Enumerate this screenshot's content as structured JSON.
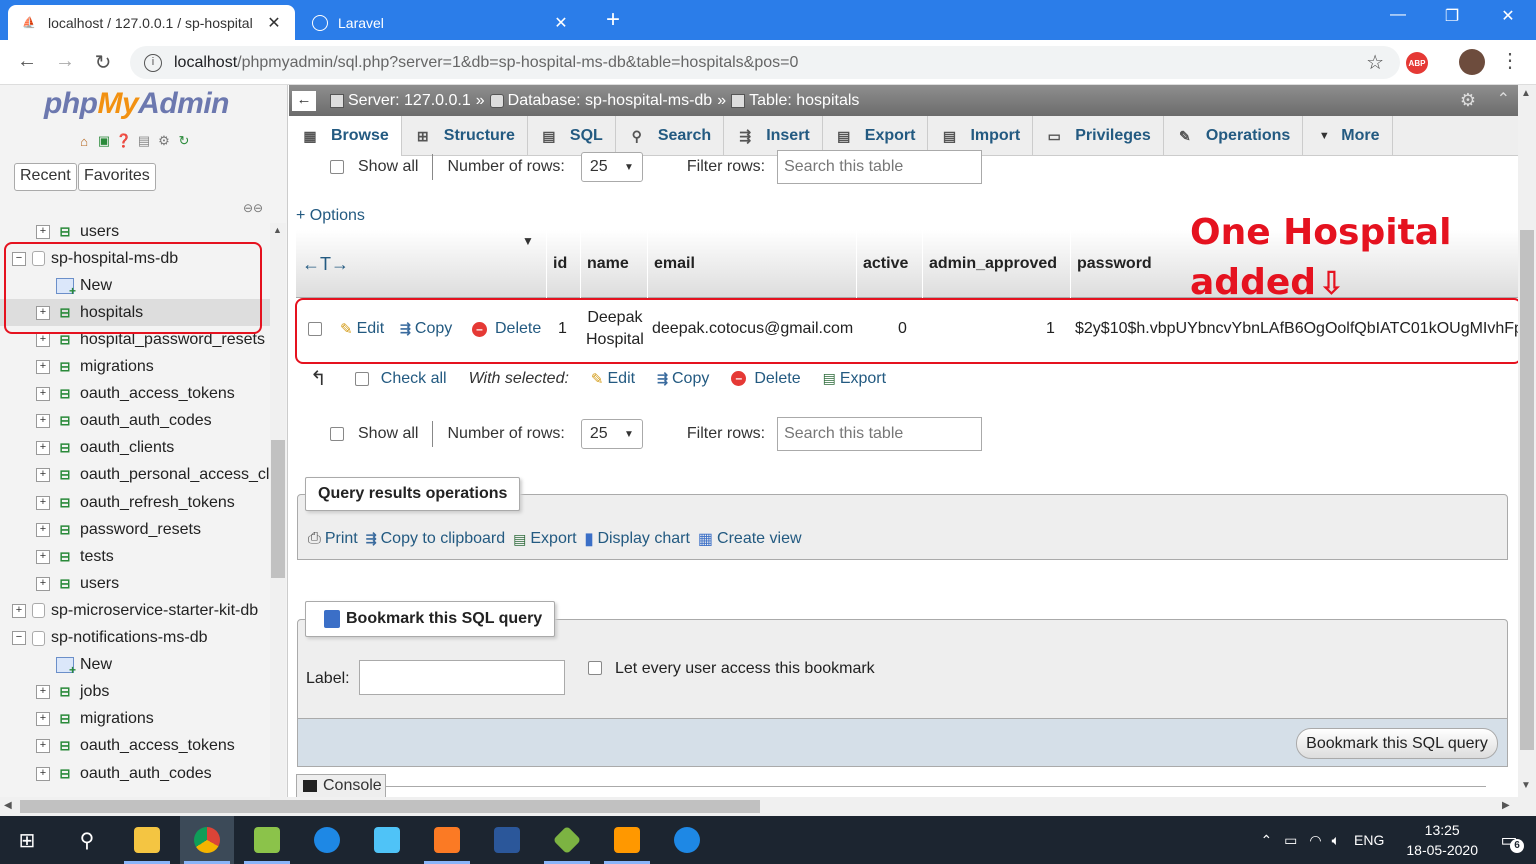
{
  "browser": {
    "tabs": [
      {
        "title": "localhost / 127.0.0.1 / sp-hospital",
        "favicon": "pma",
        "active": true
      },
      {
        "title": "Laravel",
        "favicon": "globe",
        "active": false
      }
    ],
    "url_host": "localhost",
    "url_path": "/phpmyadmin/sql.php?server=1&db=sp-hospital-ms-db&table=hospitals&pos=0",
    "abp_label": "ABP"
  },
  "sidebar": {
    "logo_php": "php",
    "logo_my": "My",
    "logo_admin": "Admin",
    "recent_label": "Recent",
    "favorites_label": "Favorites",
    "tree": [
      {
        "label": "users",
        "type": "table",
        "indent": 1
      },
      {
        "label": "sp-hospital-ms-db",
        "type": "db",
        "indent": 0,
        "expanded": true
      },
      {
        "label": "New",
        "type": "new",
        "indent": 1
      },
      {
        "label": "hospitals",
        "type": "table",
        "indent": 1,
        "selected": true
      },
      {
        "label": "hospital_password_resets",
        "type": "table",
        "indent": 1
      },
      {
        "label": "migrations",
        "type": "table",
        "indent": 1
      },
      {
        "label": "oauth_access_tokens",
        "type": "table",
        "indent": 1
      },
      {
        "label": "oauth_auth_codes",
        "type": "table",
        "indent": 1
      },
      {
        "label": "oauth_clients",
        "type": "table",
        "indent": 1
      },
      {
        "label": "oauth_personal_access_cl",
        "type": "table",
        "indent": 1
      },
      {
        "label": "oauth_refresh_tokens",
        "type": "table",
        "indent": 1
      },
      {
        "label": "password_resets",
        "type": "table",
        "indent": 1
      },
      {
        "label": "tests",
        "type": "table",
        "indent": 1
      },
      {
        "label": "users",
        "type": "table",
        "indent": 1
      },
      {
        "label": "sp-microservice-starter-kit-db",
        "type": "db",
        "indent": 0,
        "expanded": false
      },
      {
        "label": "sp-notifications-ms-db",
        "type": "db",
        "indent": 0,
        "expanded": true
      },
      {
        "label": "New",
        "type": "new",
        "indent": 1
      },
      {
        "label": "jobs",
        "type": "table",
        "indent": 1
      },
      {
        "label": "migrations",
        "type": "table",
        "indent": 1
      },
      {
        "label": "oauth_access_tokens",
        "type": "table",
        "indent": 1
      },
      {
        "label": "oauth_auth_codes",
        "type": "table",
        "indent": 1
      }
    ]
  },
  "breadcrumb": {
    "server": "Server: 127.0.0.1",
    "database": "Database: sp-hospital-ms-db",
    "table": "Table: hospitals",
    "sep": "»"
  },
  "menu": [
    {
      "label": "Browse",
      "icon": "browse-icon",
      "active": true
    },
    {
      "label": "Structure",
      "icon": "structure-icon"
    },
    {
      "label": "SQL",
      "icon": "sql-icon"
    },
    {
      "label": "Search",
      "icon": "search-icon"
    },
    {
      "label": "Insert",
      "icon": "insert-icon"
    },
    {
      "label": "Export",
      "icon": "export-icon"
    },
    {
      "label": "Import",
      "icon": "import-icon"
    },
    {
      "label": "Privileges",
      "icon": "privileges-icon"
    },
    {
      "label": "Operations",
      "icon": "operations-icon"
    },
    {
      "label": "More",
      "icon": "chevron-down-icon"
    }
  ],
  "nav_controls": {
    "show_all": "Show all",
    "rows_label": "Number of rows:",
    "rows_value": "25",
    "filter_label": "Filter rows:",
    "filter_placeholder": "Search this table"
  },
  "options_link": "+ Options",
  "table": {
    "arrows": "←T→",
    "columns": [
      "id",
      "name",
      "email",
      "active",
      "admin_approved",
      "password"
    ],
    "row": {
      "edit": "Edit",
      "copy": "Copy",
      "delete": "Delete",
      "id": "1",
      "name_line1": "Deepak",
      "name_line2": "Hospital",
      "email": "deepak.cotocus@gmail.com",
      "active": "0",
      "admin_approved": "1",
      "password": "$2y$10$h.vbpUYbncvYbnLAfB6OgOolfQbIATC01kOUgMIvhFp"
    }
  },
  "annotation": {
    "line1": "One Hospital",
    "line2": "added",
    "color": "#e5121f"
  },
  "with_selected": {
    "check_all": "Check all",
    "label": "With selected:",
    "edit": "Edit",
    "copy": "Copy",
    "delete": "Delete",
    "export": "Export"
  },
  "query_ops": {
    "legend": "Query results operations",
    "print": "Print",
    "copy_clipboard": "Copy to clipboard",
    "export": "Export",
    "display_chart": "Display chart",
    "create_view": "Create view"
  },
  "bookmark": {
    "legend": "Bookmark this SQL query",
    "label": "Label:",
    "every_user": "Let every user access this bookmark",
    "button": "Bookmark this SQL query"
  },
  "console_label": "Console",
  "taskbar": {
    "lang": "ENG",
    "time": "13:25",
    "date": "18-05-2020",
    "notifications": "6"
  }
}
